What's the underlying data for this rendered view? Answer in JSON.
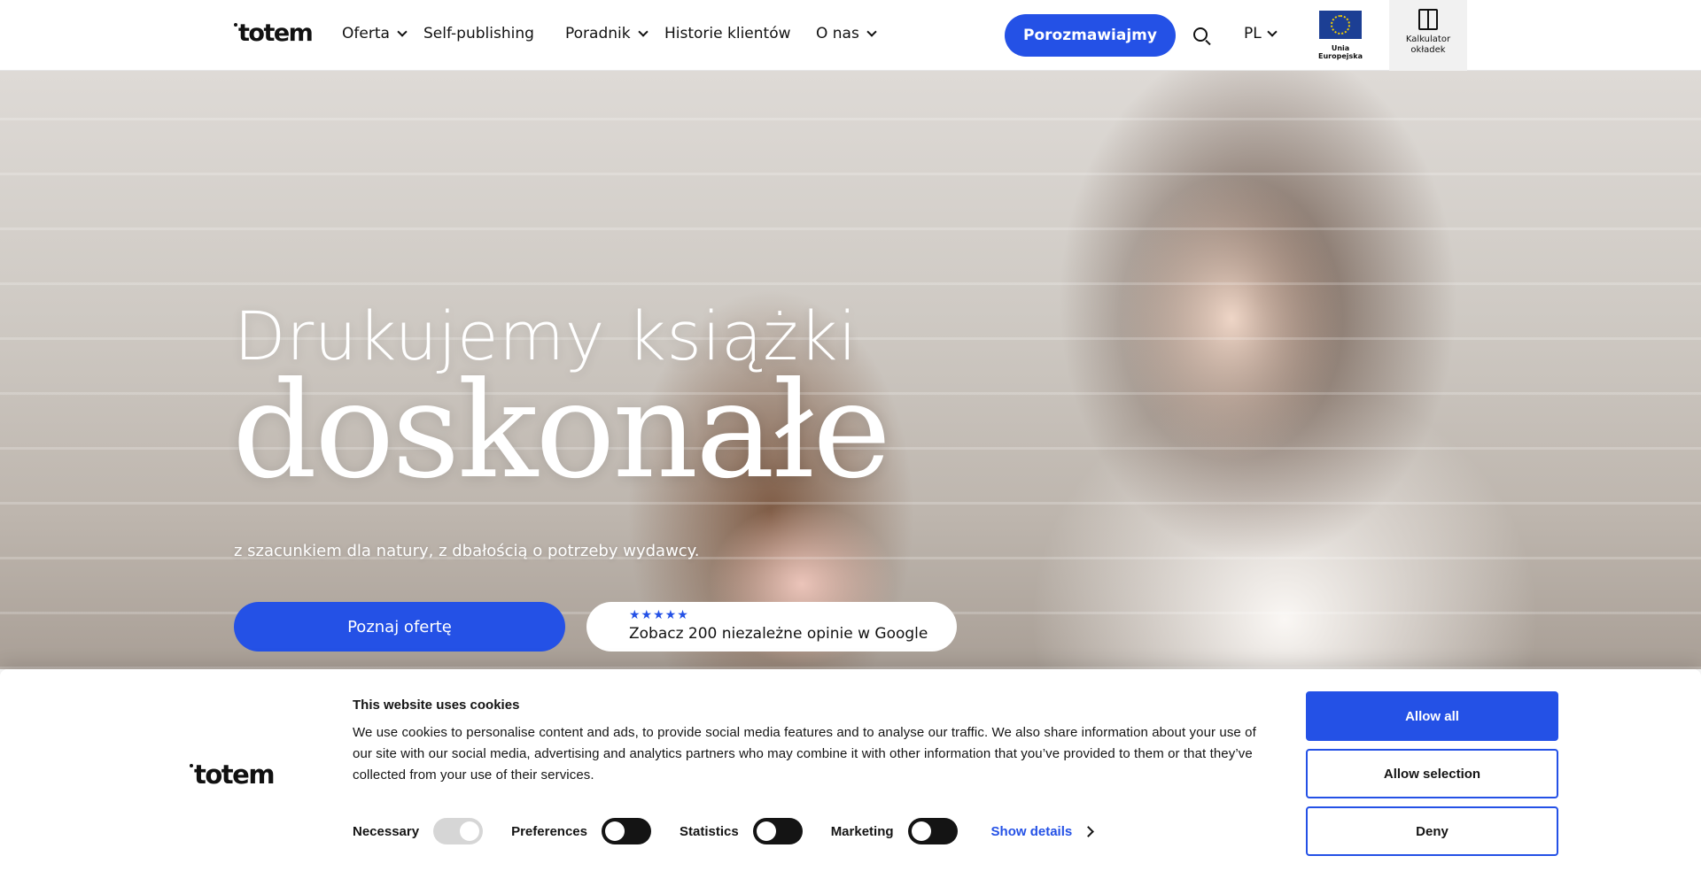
{
  "header": {
    "logo": "totem",
    "nav": [
      {
        "label": "Oferta",
        "dropdown": true
      },
      {
        "label": "Self-publishing",
        "dropdown": false
      },
      {
        "label": "Poradnik",
        "dropdown": true
      },
      {
        "label": "Historie klientów",
        "dropdown": false
      },
      {
        "label": "O nas",
        "dropdown": true
      }
    ],
    "cta_label": "Porozmawiajmy",
    "language": "PL",
    "eu_label": "Unia Europejska",
    "calc_label_1": "Kalkulator",
    "calc_label_2": "okładek"
  },
  "hero": {
    "title": "Drukujemy książki",
    "title_big": "doskonałe",
    "subtitle": "z szacunkiem dla natury, z dbałością o potrzeby wydawcy.",
    "cta_label": "Poznaj ofertę",
    "reviews_stars": "★★★★★",
    "reviews_text": "Zobacz 200 niezależne opinie w Google"
  },
  "cookie": {
    "logo": "totem",
    "title": "This website uses cookies",
    "text": "We use cookies to personalise content and ads, to provide social media features and to analyse our traffic. We also share information about your use of our site with our social media, advertising and analytics partners who may combine it with other information that you’ve provided to them or that they’ve collected from your use of their services.",
    "toggles": [
      {
        "label": "Necessary",
        "enabled": true,
        "locked": true
      },
      {
        "label": "Preferences",
        "enabled": false
      },
      {
        "label": "Statistics",
        "enabled": false
      },
      {
        "label": "Marketing",
        "enabled": false
      }
    ],
    "show_details": "Show details",
    "allow_all": "Allow all",
    "allow_selection": "Allow selection",
    "deny": "Deny"
  },
  "colors": {
    "accent": "#2451e6",
    "text": "#111111",
    "toggle_off": "#141414",
    "toggle_locked": "#d6d6d6"
  }
}
